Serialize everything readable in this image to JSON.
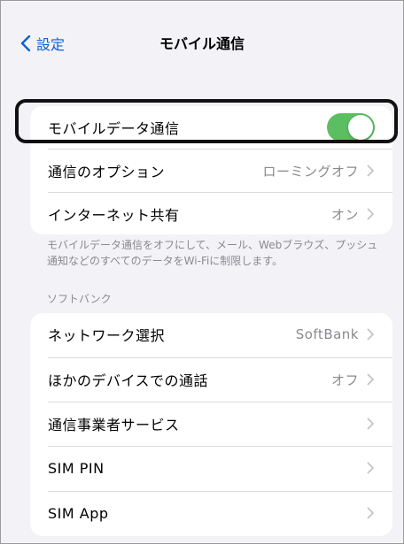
{
  "nav": {
    "back_label": "設定",
    "title": "モバイル通信"
  },
  "group1": {
    "mobile_data": {
      "label": "モバイルデータ通信",
      "enabled": true
    },
    "options": {
      "label": "通信のオプション",
      "value": "ローミングオフ"
    },
    "hotspot": {
      "label": "インターネット共有",
      "value": "オン"
    }
  },
  "footnote": "モバイルデータ通信をオフにして、メール、Webブラウズ、プッシュ通知などのすべてのデータをWi-Fiに制限します。",
  "section_header": "ソフトバンク",
  "group2": {
    "network": {
      "label": "ネットワーク選択",
      "value": "SoftBank"
    },
    "calls_on_other": {
      "label": "ほかのデバイスでの通話",
      "value": "オフ"
    },
    "carrier_services": {
      "label": "通信事業者サービス"
    },
    "sim_pin": {
      "label": "SIM PIN"
    },
    "sim_app": {
      "label": "SIM App"
    }
  },
  "colors": {
    "accent": "#0a60d8",
    "toggle_on": "#5bbf62",
    "secondary_text": "#8a8a8e",
    "background": "#f2f2f7"
  }
}
